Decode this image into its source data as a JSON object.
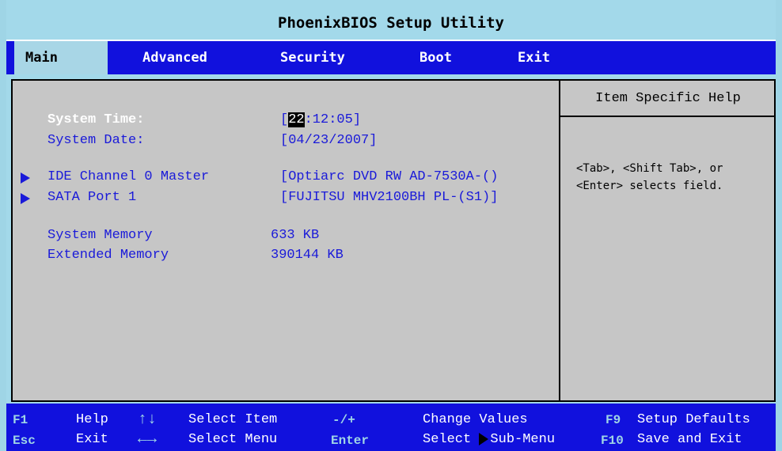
{
  "title": "PhoenixBIOS Setup Utility",
  "menu": {
    "tabs": [
      {
        "label": "Main",
        "active": true
      },
      {
        "label": "Advanced"
      },
      {
        "label": "Security"
      },
      {
        "label": "Boot"
      },
      {
        "label": "Exit"
      }
    ]
  },
  "main": {
    "system_time": {
      "label": "System Time:",
      "hour": "22",
      "rest": ":12:05]",
      "open": "["
    },
    "system_date": {
      "label": "System Date:",
      "value": "[04/23/2007]"
    },
    "ide": {
      "label": "IDE Channel 0 Master",
      "value": "[Optiarc DVD RW AD-7530A-()"
    },
    "sata": {
      "label": "SATA Port 1",
      "value": "[FUJITSU MHV2100BH PL-(S1)]"
    },
    "sys_mem": {
      "label": "System Memory",
      "value": "633 KB"
    },
    "ext_mem": {
      "label": "Extended Memory",
      "value": "390144 KB"
    }
  },
  "help": {
    "header": "Item Specific Help",
    "line1": "<Tab>, <Shift Tab>, or",
    "line2": "<Enter> selects field."
  },
  "footer": {
    "f1": "F1",
    "help": "Help",
    "arrows_ud": "↑↓",
    "select_item": "Select Item",
    "minus_plus": "-/+",
    "change_values": "Change Values",
    "f9": "F9",
    "setup_defaults": "Setup Defaults",
    "esc": "Esc",
    "exit": "Exit",
    "arrows_lr": "←→",
    "select_menu": "Select Menu",
    "enter": "Enter",
    "select_submenu": "Select",
    "submenu": "Sub-Menu",
    "f10": "F10",
    "save_exit": "Save and Exit"
  },
  "colors": {
    "accent_blue": "#1111dd",
    "panel_gray": "#c6c6c6",
    "title_cyan": "#a3d9ea"
  }
}
